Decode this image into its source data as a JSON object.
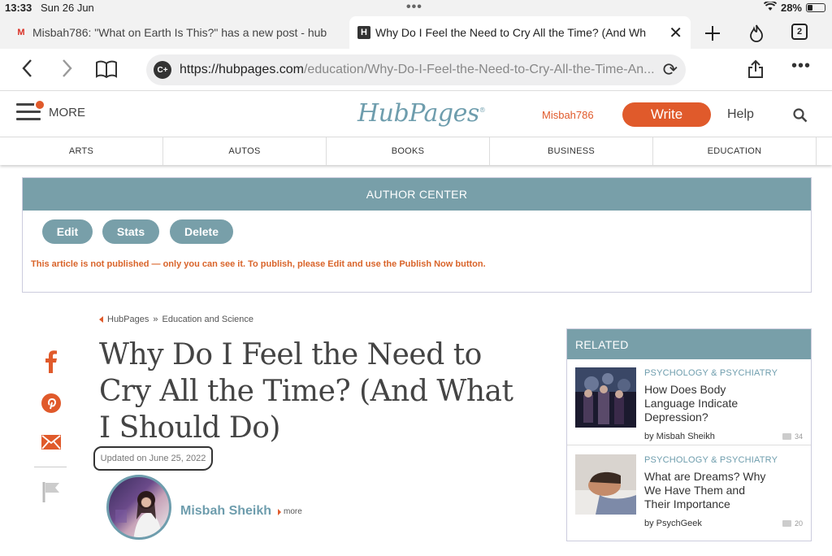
{
  "statusbar": {
    "time": "13:33",
    "date": "Sun 26 Jun",
    "battery": "28%",
    "dots": "•••"
  },
  "tabs": [
    {
      "label": "Misbah786: \"What on Earth Is This?\" has a new post - hub",
      "favicon": "M"
    },
    {
      "label": "Why Do I Feel the Need to Cry All the Time? (And Wh",
      "favicon": "H"
    }
  ],
  "tabcount": "2",
  "url": {
    "host": "https://hubpages.com",
    "path": "/education/Why-Do-I-Feel-the-Need-to-Cry-All-the-Time-An..."
  },
  "site": {
    "more_label": "MORE",
    "logo": "HubPages",
    "username": "Misbah786",
    "write_label": "Write",
    "help_label": "Help"
  },
  "categories": [
    "ARTS",
    "AUTOS",
    "BOOKS",
    "BUSINESS",
    "EDUCATION"
  ],
  "author_center": {
    "title": "AUTHOR CENTER",
    "edit": "Edit",
    "stats": "Stats",
    "delete": "Delete",
    "warning": "This article is not published — only you can see it. To publish, please Edit and use the Publish Now button."
  },
  "article": {
    "breadcrumb_home": "HubPages",
    "breadcrumb_sep": "»",
    "breadcrumb_section": "Education and Science",
    "title": "Why Do I Feel the Need to Cry All the Time? (And What I Should Do)",
    "updated": "Updated on June 25, 2022",
    "author": "Misbah Sheikh",
    "author_more": "more"
  },
  "related": {
    "heading": "RELATED",
    "items": [
      {
        "category": "PSYCHOLOGY & PSYCHIATRY",
        "title": "How Does Body Language Indicate Depression?",
        "by": "by Misbah Sheikh",
        "comments": "34"
      },
      {
        "category": "PSYCHOLOGY & PSYCHIATRY",
        "title": "What are Dreams? Why We Have Them and Their Importance",
        "by": "by PsychGeek",
        "comments": "20"
      }
    ]
  },
  "colors": {
    "accent": "#e05a2b",
    "teal": "#789fa9",
    "brand": "#6e9dad"
  }
}
